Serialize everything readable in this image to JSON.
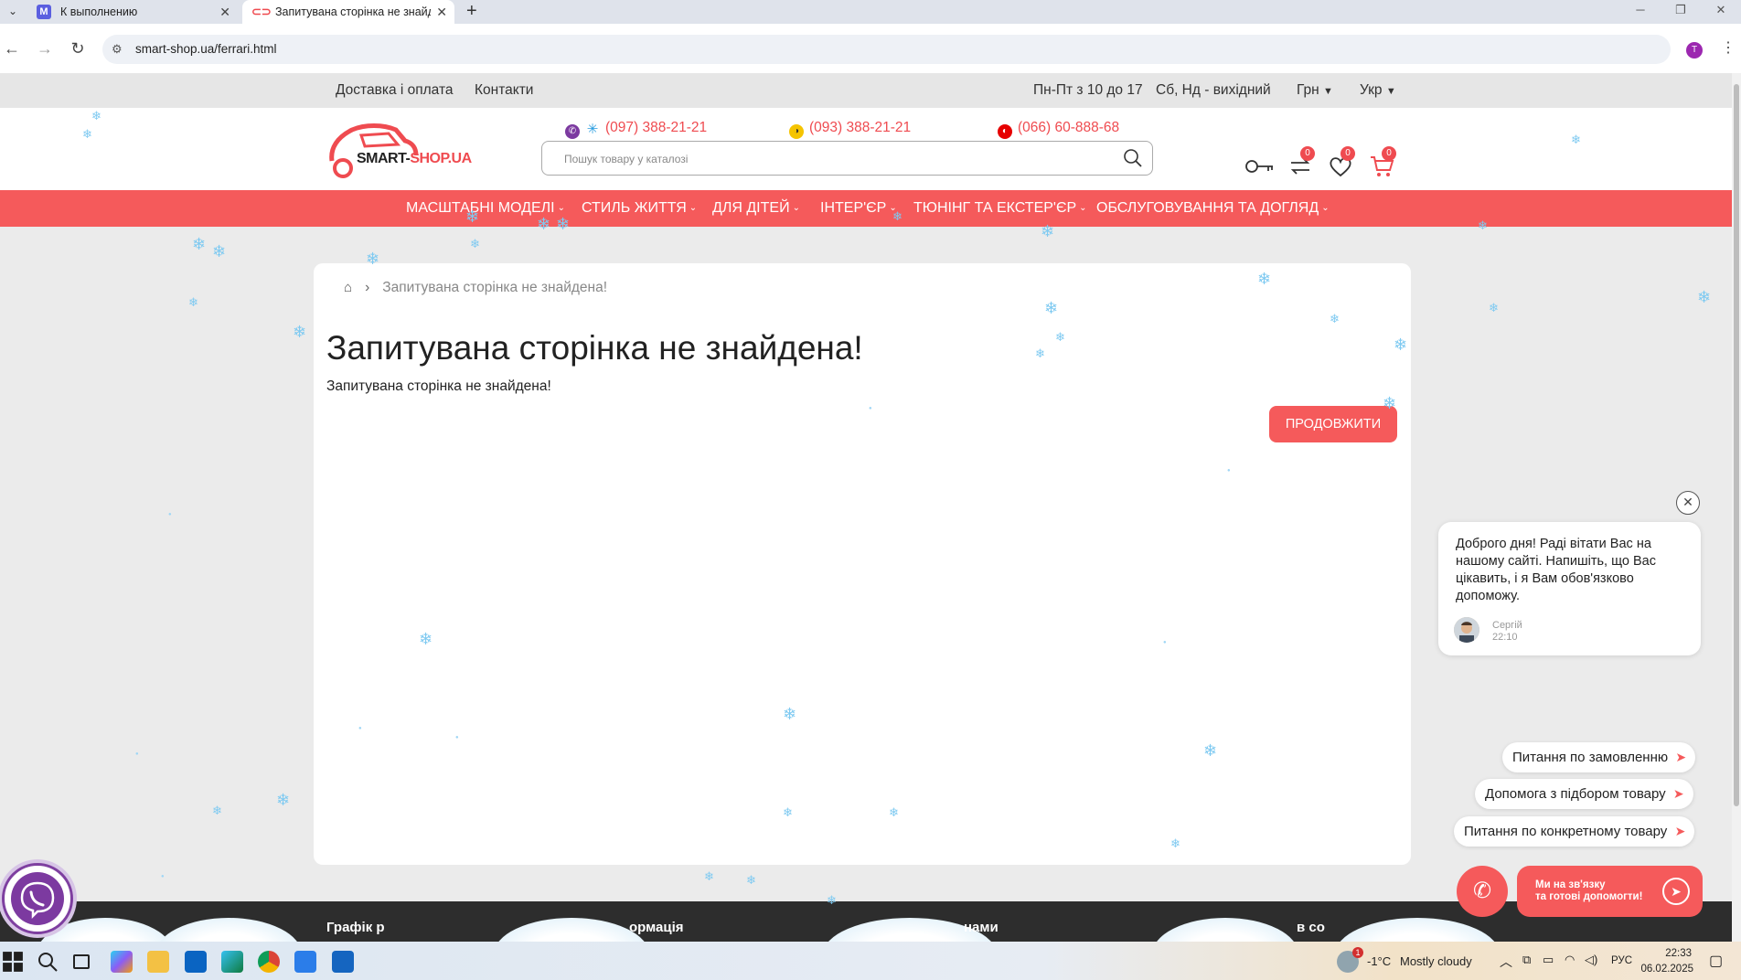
{
  "browser": {
    "tabs": [
      {
        "title": "К выполнению",
        "icon": "M",
        "active": false
      },
      {
        "title": "Запитувана сторінка не знайд",
        "icon": "car",
        "active": true
      }
    ],
    "new_tab": "+",
    "url": "smart-shop.ua/ferrari.html",
    "profile_initial": "T"
  },
  "topbar": {
    "links": [
      "Доставка і оплата",
      "Контакти"
    ],
    "hours_weekdays": "Пн-Пт з 10 до 17",
    "hours_weekend": "Сб, Нд - вихідний",
    "currency": "Грн",
    "language": "Укр"
  },
  "header": {
    "logo_text_a": "SMART-",
    "logo_text_b": "SHOP.UA",
    "phones": [
      "(097) 388-21-21",
      "(093) 388-21-21",
      "(066) 60-888-68"
    ],
    "search_placeholder": "Пошук товару у каталозі",
    "compare_count": "0",
    "wishlist_count": "0",
    "cart_count": "0"
  },
  "menu": [
    "Масштабні моделі",
    "Стиль життя",
    "Для дітей",
    "Інтер'єр",
    "Тюнінг та екстер'єр",
    "Обслуговування та догляд"
  ],
  "content": {
    "breadcrumb": "Запитувана сторінка не знайдена!",
    "heading": "Запитувана сторінка не знайдена!",
    "message": "Запитувана сторінка не знайдена!",
    "continue_button": "Продовжити"
  },
  "footer": {
    "titles": [
      "Графік р",
      "ормація",
      "нами",
      "в со"
    ]
  },
  "chat": {
    "greeting": "Доброго дня! Раді вітати Вас на нашому сайті. Напишіть, що Вас цікавить, і я Вам обов'язково допоможу.",
    "agent_name": "Сергій",
    "agent_time": "22:10",
    "quick_replies": [
      "Питання по замовленню",
      "Допомога з підбором товару",
      "Питання по конкретному товару"
    ],
    "telegram_text_1": "Ми на зв'язку",
    "telegram_text_2": "та готові допомогти!"
  },
  "taskbar": {
    "weather_temp": "-1°C",
    "weather_desc": "Mostly cloudy",
    "language": "РУС",
    "time": "22:33",
    "date": "06.02.2025",
    "weather_badge": "1"
  },
  "colors": {
    "accent": "#f55a5b",
    "footer": "#2d2d2d",
    "snow": "#7fcaf1"
  }
}
